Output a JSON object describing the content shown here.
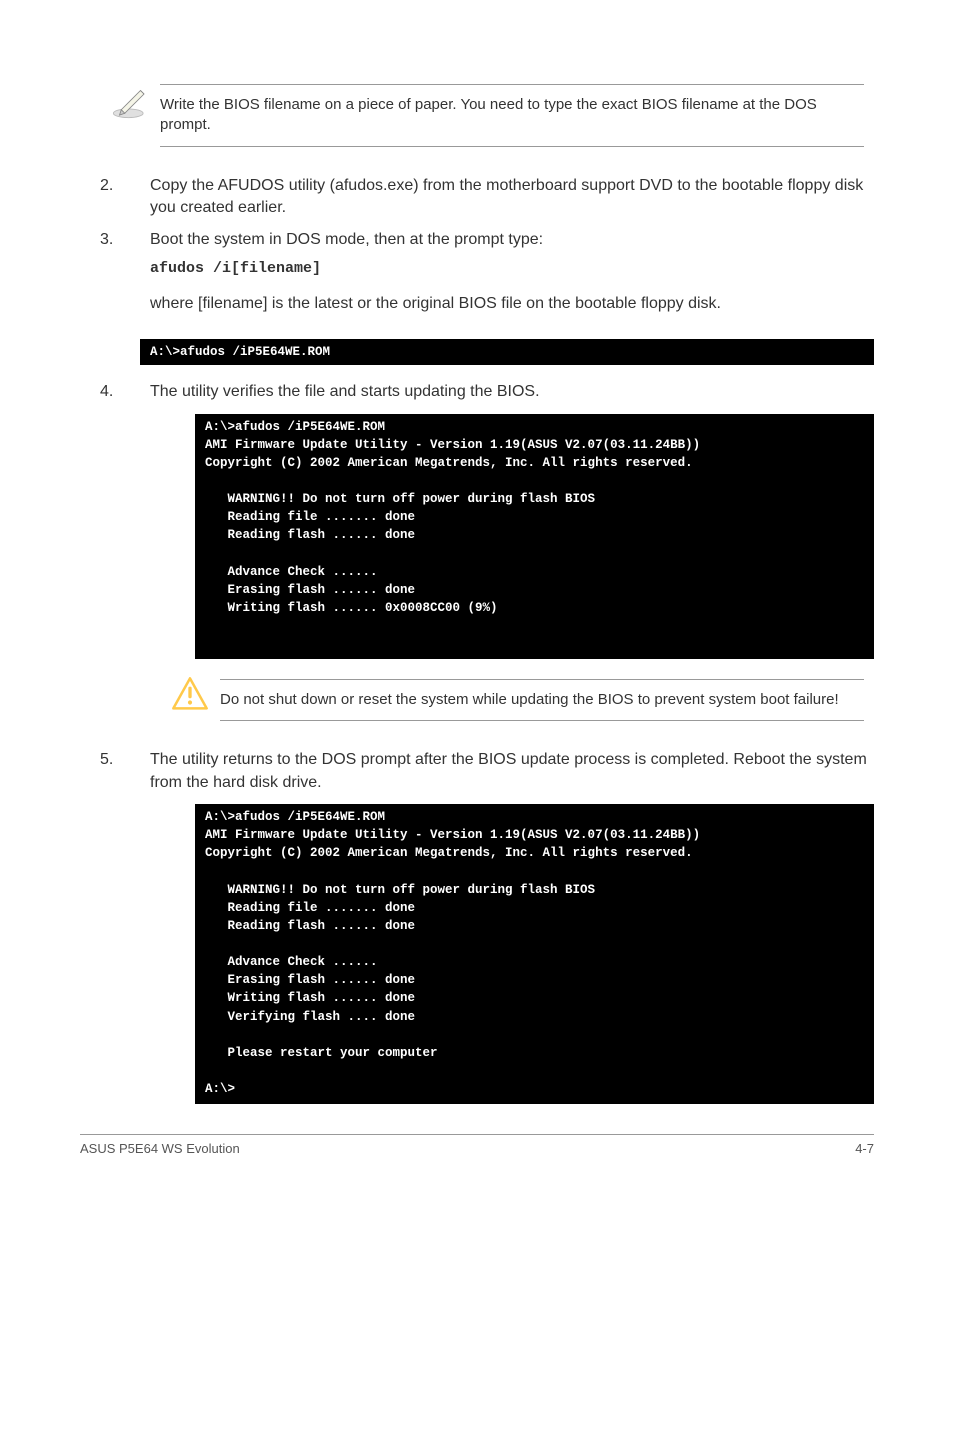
{
  "note1": {
    "text": "Write the BIOS filename on a piece of paper. You need to type the exact BIOS filename at the DOS prompt."
  },
  "steps": {
    "s2": {
      "num": "2.",
      "text": "Copy the AFUDOS utility (afudos.exe) from the motherboard support DVD to the bootable floppy disk you created earlier."
    },
    "s3": {
      "num": "3.",
      "text": "Boot the system in DOS mode, then at the prompt type:",
      "cmd": "afudos /i[filename]",
      "after": "where [filename] is the latest or the original BIOS file on the bootable floppy disk."
    },
    "s4": {
      "num": "4.",
      "text": "The utility verifies the file and starts updating the BIOS."
    },
    "s5": {
      "num": "5.",
      "text": "The utility returns to the DOS prompt after the BIOS update process is completed. Reboot the system from the hard disk drive."
    }
  },
  "terminals": {
    "t1": "A:\\>afudos /iP5E64WE.ROM",
    "t2": "A:\\>afudos /iP5E64WE.ROM\nAMI Firmware Update Utility - Version 1.19(ASUS V2.07(03.11.24BB))\nCopyright (C) 2002 American Megatrends, Inc. All rights reserved.\n\n   WARNING!! Do not turn off power during flash BIOS\n   Reading file ....... done\n   Reading flash ...... done\n\n   Advance Check ......\n   Erasing flash ...... done\n   Writing flash ...... 0x0008CC00 (9%)\n\n\n",
    "t3": "A:\\>afudos /iP5E64WE.ROM\nAMI Firmware Update Utility - Version 1.19(ASUS V2.07(03.11.24BB))\nCopyright (C) 2002 American Megatrends, Inc. All rights reserved.\n\n   WARNING!! Do not turn off power during flash BIOS\n   Reading file ....... done\n   Reading flash ...... done\n\n   Advance Check ......\n   Erasing flash ...... done\n   Writing flash ...... done\n   Verifying flash .... done\n\n   Please restart your computer\n\nA:\\>"
  },
  "warning": {
    "text": "Do not shut down or reset the system while updating the BIOS to prevent system boot failure!"
  },
  "footer": {
    "left": "ASUS P5E64 WS Evolution",
    "right": "4-7"
  }
}
